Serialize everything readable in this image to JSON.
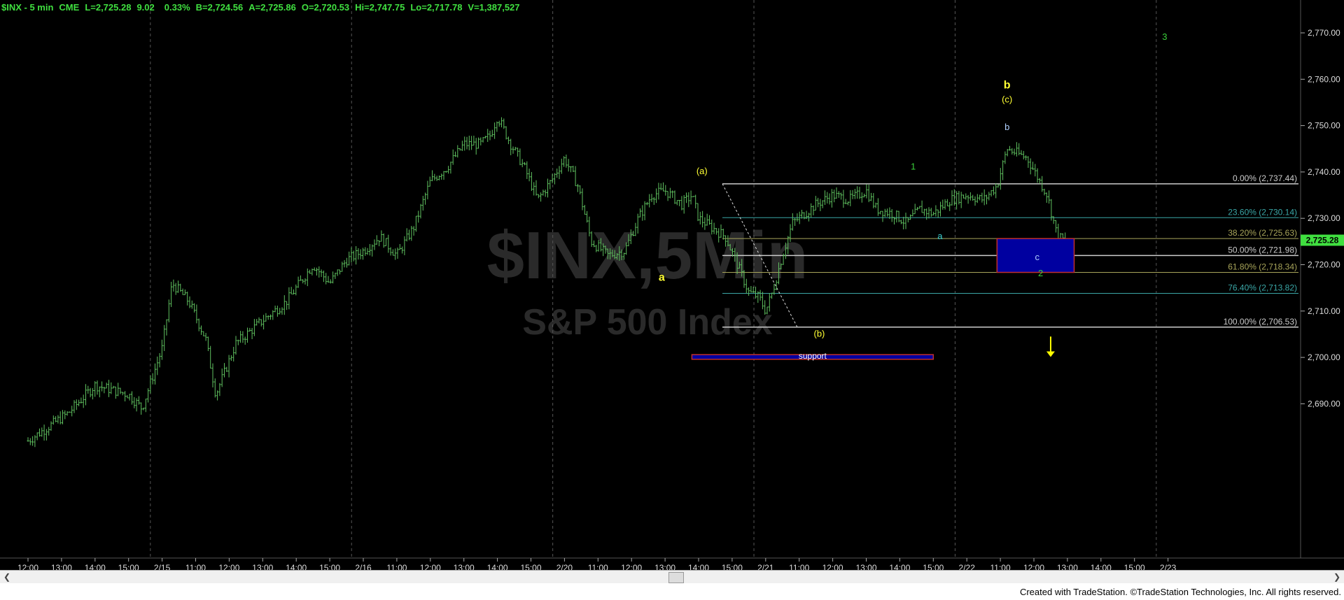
{
  "header": {
    "symbol": "$INX - 5 min",
    "exchange": "CME",
    "last": "L=2,725.28",
    "change": "9.02",
    "change_pct": "0.33%",
    "bid": "B=2,724.56",
    "ask": "A=2,725.86",
    "open": "O=2,720.53",
    "high": "Hi=2,747.75",
    "low": "Lo=2,717.78",
    "volume": "V=1,387,527"
  },
  "watermark": {
    "symbol": "$INX,5Min",
    "name": "S&P 500 Index"
  },
  "price_tag": "2,725.28",
  "footer": "Created with TradeStation. ©TradeStation Technologies, Inc. All rights reserved.",
  "colors": {
    "bars": "#5fc05f",
    "yellow": "#ffff33",
    "green": "#3acf3a",
    "cyan": "#3ad0d0",
    "label_blue": "#b0d0ff",
    "teal": "#3aa6a6",
    "olive": "#a8a55a"
  },
  "chart_data": {
    "type": "bar",
    "title": "$INX - 5 min",
    "ylim": [
      2680,
      2775
    ],
    "y_ticks": [
      "2,690.00",
      "2,700.00",
      "2,710.00",
      "2,720.00",
      "2,730.00",
      "2,740.00",
      "2,750.00",
      "2,760.00",
      "2,770.00"
    ],
    "x_ticks": [
      "12:00",
      "13:00",
      "14:00",
      "15:00",
      "2/15",
      "11:00",
      "12:00",
      "13:00",
      "14:00",
      "15:00",
      "2/16",
      "11:00",
      "12:00",
      "13:00",
      "14:00",
      "15:00",
      "2/20",
      "11:00",
      "12:00",
      "13:00",
      "14:00",
      "15:00",
      "2/21",
      "11:00",
      "12:00",
      "13:00",
      "14:00",
      "15:00",
      "2/22",
      "11:00",
      "12:00",
      "13:00",
      "14:00",
      "15:00",
      "2/23"
    ],
    "price_path": [
      [
        0,
        2682
      ],
      [
        1.2,
        2688
      ],
      [
        2,
        2694
      ],
      [
        3,
        2692
      ],
      [
        3.4,
        2689
      ],
      [
        4,
        2702
      ],
      [
        4.3,
        2716
      ],
      [
        4.8,
        2712
      ],
      [
        5.3,
        2704
      ],
      [
        5.6,
        2692
      ],
      [
        6.2,
        2703
      ],
      [
        7,
        2708
      ],
      [
        7.7,
        2712
      ],
      [
        8.5,
        2720
      ],
      [
        9,
        2716
      ],
      [
        9.5,
        2721
      ],
      [
        10,
        2723
      ],
      [
        10.5,
        2726
      ],
      [
        11,
        2722
      ],
      [
        11.5,
        2728
      ],
      [
        12,
        2738
      ],
      [
        12.5,
        2741
      ],
      [
        13,
        2746
      ],
      [
        13.5,
        2746
      ],
      [
        13.8,
        2748
      ],
      [
        14,
        2752
      ],
      [
        14.4,
        2746
      ],
      [
        14.8,
        2741
      ],
      [
        15.2,
        2734
      ],
      [
        15.6,
        2738
      ],
      [
        16,
        2743
      ],
      [
        16.4,
        2737
      ],
      [
        16.8,
        2725
      ],
      [
        17.3,
        2722
      ],
      [
        17.8,
        2723
      ],
      [
        18.2,
        2730
      ],
      [
        18.6,
        2735
      ],
      [
        19,
        2736
      ],
      [
        19.5,
        2733
      ],
      [
        19.8,
        2735
      ],
      [
        20,
        2730
      ],
      [
        20.4,
        2728
      ],
      [
        20.8,
        2726
      ],
      [
        21.1,
        2721
      ],
      [
        21.5,
        2714
      ],
      [
        21.8,
        2713
      ],
      [
        22,
        2710
      ],
      [
        22.2,
        2714
      ],
      [
        22.5,
        2722
      ],
      [
        22.8,
        2729
      ],
      [
        23.5,
        2733
      ],
      [
        24,
        2735
      ],
      [
        24.5,
        2734
      ],
      [
        25,
        2736
      ],
      [
        25.3,
        2732
      ],
      [
        25.8,
        2731
      ],
      [
        26.2,
        2729
      ],
      [
        26.6,
        2732
      ],
      [
        27,
        2731
      ],
      [
        27.5,
        2734
      ],
      [
        28,
        2735
      ],
      [
        28.5,
        2734
      ],
      [
        28.9,
        2737
      ],
      [
        29.2,
        2745
      ],
      [
        29.5,
        2744
      ],
      [
        29.8,
        2743
      ],
      [
        30.1,
        2739
      ],
      [
        30.4,
        2735
      ],
      [
        30.7,
        2726
      ],
      [
        31,
        2725
      ]
    ],
    "fibonacci": {
      "from": 2737.44,
      "to": 2706.53,
      "levels": [
        {
          "label": "0.00% (2,737.44)",
          "value": 2737.44,
          "color": "#cccccc"
        },
        {
          "label": "23.60% (2,730.14)",
          "value": 2730.14,
          "color": "#3aa6a6"
        },
        {
          "label": "38.20% (2,725.63)",
          "value": 2725.63,
          "color": "#a8a55a"
        },
        {
          "label": "50.00% (2,721.98)",
          "value": 2721.98,
          "color": "#cccccc"
        },
        {
          "label": "61.80% (2,718.34)",
          "value": 2718.34,
          "color": "#a8a55a"
        },
        {
          "label": "76.40% (2,713.82)",
          "value": 2713.82,
          "color": "#3aa6a6"
        },
        {
          "label": "100.00% (2,706.53)",
          "value": 2706.53,
          "color": "#cccccc"
        }
      ]
    },
    "target_box": {
      "x0": 28.9,
      "x1": 31.2,
      "y0": 2725.63,
      "y1": 2718.34
    },
    "support_box": {
      "x0": 19.8,
      "x1": 27.0,
      "y0": 2700.6,
      "y1": 2699.6,
      "label": "support"
    },
    "annotations": [
      {
        "text": "a",
        "x": 18.9,
        "y": 2716.5,
        "color": "#ffff33",
        "bold": true
      },
      {
        "text": "(a)",
        "x": 20.1,
        "y": 2739.5,
        "color": "#ffff33",
        "bold": false
      },
      {
        "text": "(b)",
        "x": 23.6,
        "y": 2704.5,
        "color": "#ffff33",
        "bold": false
      },
      {
        "text": "1",
        "x": 26.4,
        "y": 2740.5,
        "color": "#3acf3a",
        "bold": false
      },
      {
        "text": "a",
        "x": 27.2,
        "y": 2725.5,
        "color": "#3ad0d0",
        "bold": false
      },
      {
        "text": "b",
        "x": 29.2,
        "y": 2758,
        "color": "#ffff33",
        "bold": true
      },
      {
        "text": "(c)",
        "x": 29.2,
        "y": 2755,
        "color": "#ffff33",
        "bold": false
      },
      {
        "text": "b",
        "x": 29.2,
        "y": 2749,
        "color": "#b0d0ff",
        "bold": false
      },
      {
        "text": "c",
        "x": 30.1,
        "y": 2721,
        "color": "#b0d0ff",
        "bold": false
      },
      {
        "text": "2",
        "x": 30.2,
        "y": 2717.5,
        "color": "#3acf3a",
        "bold": false
      },
      {
        "text": "3",
        "x": 33.9,
        "y": 2768.5,
        "color": "#3acf3a",
        "bold": false
      }
    ],
    "arrow": {
      "x": 30.5,
      "y0": 2704.5,
      "y1": 2701,
      "color": "#ffff00"
    }
  }
}
